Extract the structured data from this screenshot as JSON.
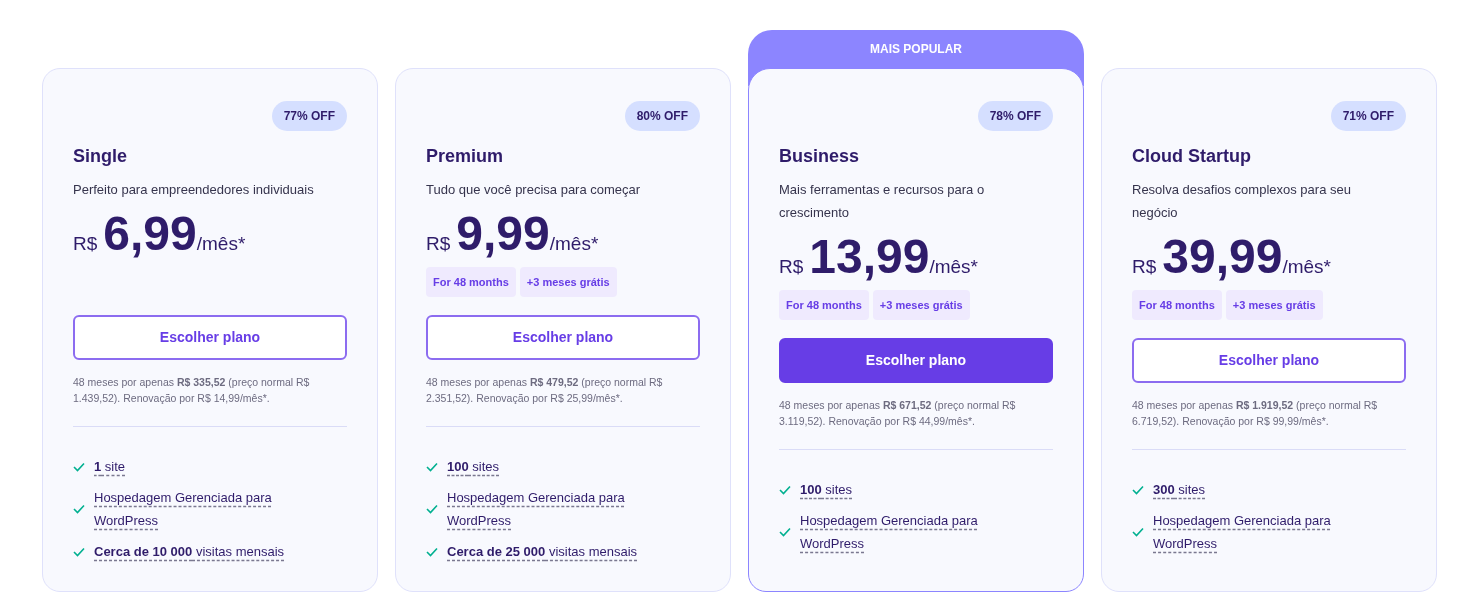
{
  "plans": [
    {
      "name": "Single",
      "discount": "77% OFF",
      "description": "Perfeito para empreendedores individuais",
      "currency": "R$",
      "price": "6,99",
      "period": "/mês*",
      "button": "Escolher plano",
      "highlighted": false,
      "footnote": "48 meses por apenas **R$ 335,52** (preço normal R$ 1.439,52). Renovação por R$ 14,99/mês*.",
      "features": [
        "**1** site",
        "Hospedagem Gerenciada para WordPress",
        "**Cerca de 10 000** visitas mensais"
      ]
    },
    {
      "name": "Premium",
      "discount": "80% OFF",
      "description": "Tudo que você precisa para começar",
      "currency": "R$",
      "price": "9,99",
      "period": "/mês*",
      "tags": [
        "For 48 months",
        "+3 meses grátis"
      ],
      "button": "Escolher plano",
      "highlighted": false,
      "footnote": "48 meses por apenas **R$ 479,52** (preço normal R$ 2.351,52). Renovação por R$ 25,99/mês*.",
      "features": [
        "**100** sites",
        "Hospedagem Gerenciada para WordPress",
        "**Cerca de 25 000** visitas mensais"
      ]
    },
    {
      "ribbon": "MAIS POPULAR",
      "name": "Business",
      "discount": "78% OFF",
      "description": "Mais ferramentas e recursos para o crescimento",
      "currency": "R$",
      "price": "13,99",
      "period": "/mês*",
      "tags": [
        "For 48 months",
        "+3 meses grátis"
      ],
      "button": "Escolher plano",
      "highlighted": true,
      "footnote": "48 meses por apenas **R$ 671,52** (preço normal R$ 3.119,52). Renovação por R$ 44,99/mês*.",
      "features": [
        "**100** sites",
        "Hospedagem Gerenciada para WordPress"
      ]
    },
    {
      "name": "Cloud Startup",
      "discount": "71% OFF",
      "description": "Resolva desafios complexos para seu negócio",
      "currency": "R$",
      "price": "39,99",
      "period": "/mês*",
      "tags": [
        "For 48 months",
        "+3 meses grátis"
      ],
      "button": "Escolher plano",
      "highlighted": false,
      "footnote": "48 meses por apenas **R$ 1.919,52** (preço normal R$ 6.719,52). Renovação por R$ 99,99/mês*.",
      "features": [
        "**300** sites",
        "Hospedagem Gerenciada para WordPress"
      ]
    }
  ]
}
